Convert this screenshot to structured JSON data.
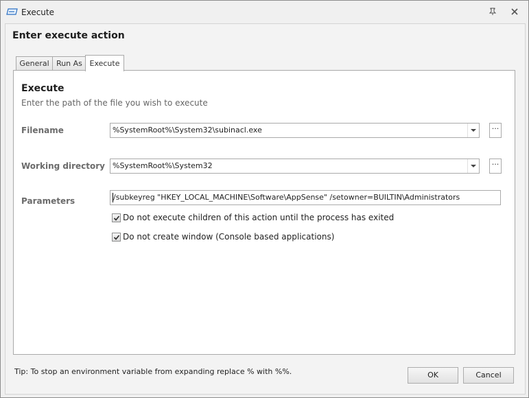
{
  "window": {
    "title": "Execute"
  },
  "dialog": {
    "heading": "Enter execute action"
  },
  "tabs": [
    {
      "label": "General",
      "selected": false
    },
    {
      "label": "Run As",
      "selected": false
    },
    {
      "label": "Execute",
      "selected": true
    }
  ],
  "panel": {
    "title": "Execute",
    "subtitle": "Enter the path of the file you wish to execute"
  },
  "fields": {
    "filename": {
      "label": "Filename",
      "value": "%SystemRoot%\\System32\\subinacl.exe",
      "browse_label": "···"
    },
    "working_directory": {
      "label": "Working directory",
      "value": "%SystemRoot%\\System32",
      "browse_label": "···"
    },
    "parameters": {
      "label": "Parameters",
      "value": "/subkeyreg \"HKEY_LOCAL_MACHINE\\Software\\AppSense\" /setowner=BUILTIN\\Administrators"
    }
  },
  "options": [
    {
      "label": "Do not execute children of this action until the process has exited",
      "checked": true
    },
    {
      "label": "Do not create window (Console based applications)",
      "checked": true
    }
  ],
  "footer": {
    "tip": "Tip: To stop an environment variable from expanding replace % with %%.",
    "ok_label": "OK",
    "cancel_label": "Cancel"
  },
  "icons": {
    "app": "execute-icon",
    "pin": "pin-icon",
    "close": "close-icon",
    "dropdown": "chevron-down-icon",
    "check": "checkmark-icon"
  },
  "colors": {
    "accent_blue": "#2b6fc2",
    "panel_background": "#ffffff",
    "label_gray": "#6b6b6b"
  }
}
